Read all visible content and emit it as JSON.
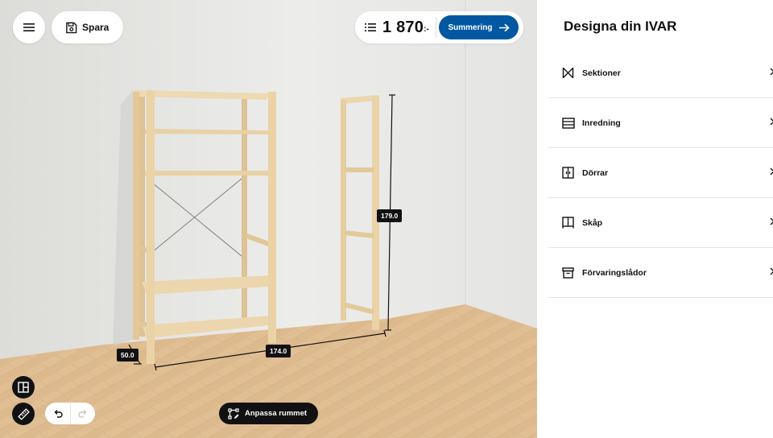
{
  "toolbar": {
    "menu_icon": "hamburger-icon",
    "save_label": "Spara",
    "save_icon": "floppy-disk-icon",
    "list_icon": "list-icon",
    "price": "1 870",
    "price_suffix": ":-",
    "summary_label": "Summering",
    "summary_icon": "arrow-right-icon"
  },
  "dimensions": {
    "height": "179.0",
    "width": "174.0",
    "depth": "50.0"
  },
  "bottom_controls": {
    "layout_icon": "layout-grid-icon",
    "measure_icon": "ruler-icon",
    "undo_icon": "undo-icon",
    "redo_icon": "redo-icon",
    "adjust_room_label": "Anpassa rummet",
    "adjust_room_icon": "room-edit-icon"
  },
  "panel": {
    "title": "Designa din IVAR",
    "items": [
      {
        "label": "Sektioner",
        "icon": "sections-icon"
      },
      {
        "label": "Inredning",
        "icon": "shelf-interior-icon"
      },
      {
        "label": "Dörrar",
        "icon": "doors-icon"
      },
      {
        "label": "Skåp",
        "icon": "cabinet-icon"
      },
      {
        "label": "Förvaringslådor",
        "icon": "storage-box-icon"
      }
    ]
  },
  "colors": {
    "accent": "#0058a3",
    "dark": "#111111",
    "wall": "#e9e9e7",
    "floor": "#dcb88d",
    "wood": "#e6d0a6"
  }
}
